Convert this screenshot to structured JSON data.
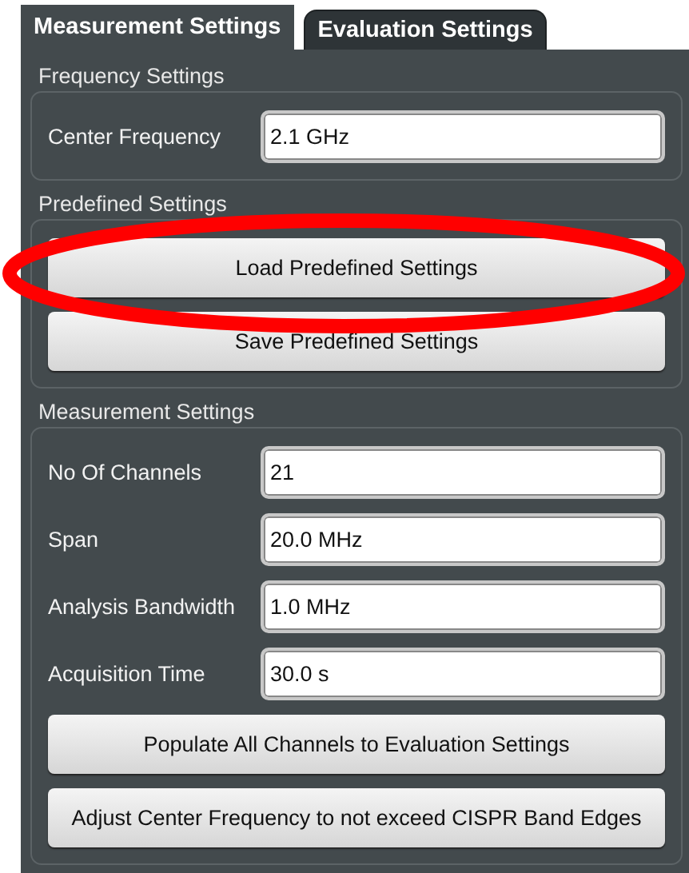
{
  "tabs": [
    {
      "label": "Measurement Settings",
      "selected": true
    },
    {
      "label": "Evaluation Settings",
      "selected": false
    }
  ],
  "groups": [
    {
      "title": "Frequency Settings",
      "fields": [
        {
          "label": "Center Frequency",
          "value": "2.1 GHz"
        }
      ]
    },
    {
      "title": "Predefined Settings",
      "buttons": [
        "Load Predefined Settings",
        "Save Predefined Settings"
      ]
    },
    {
      "title": "Measurement Settings",
      "fields": [
        {
          "label": "No Of Channels",
          "value": "21"
        },
        {
          "label": "Span",
          "value": "20.0 MHz"
        },
        {
          "label": "Analysis Bandwidth",
          "value": "1.0 MHz"
        },
        {
          "label": "Acquisition Time",
          "value": "30.0 s"
        }
      ],
      "buttons": [
        "Populate All Channels to Evaluation Settings",
        "Adjust Center Frequency to not exceed CISPR Band Edges"
      ]
    }
  ]
}
